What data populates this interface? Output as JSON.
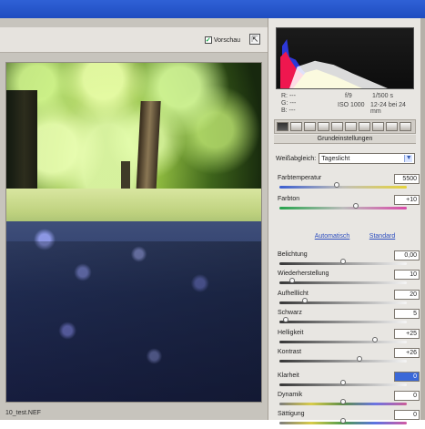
{
  "header": {
    "preview_label": "Vorschau",
    "preview_checked": true
  },
  "image": {
    "filename": "10_test.NEF"
  },
  "exif": {
    "rgb": [
      "R: ---",
      "G: ---",
      "B: ---"
    ],
    "aperture": "f/9",
    "shutter": "1/500 s",
    "iso": "ISO 1000",
    "lens": "12-24 bei 24 mm"
  },
  "panel": {
    "section_title": "Grundeinstellungen",
    "white_balance_label": "Weißabgleich:",
    "white_balance_value": "Tageslicht",
    "automatic_label": "Automatisch",
    "standard_label": "Standard"
  },
  "controls": [
    {
      "label": "Farbtemperatur",
      "value": "5500",
      "level": 0.45,
      "track": "temp"
    },
    {
      "label": "Farbton",
      "value": "+10",
      "level": 0.6,
      "track": "tint"
    },
    {
      "label": "Belichtung",
      "value": "0,00",
      "level": 0.5,
      "track": "normal"
    },
    {
      "label": "Wiederherstellung",
      "value": "10",
      "level": 0.1,
      "track": "normal"
    },
    {
      "label": "Aufhelllicht",
      "value": "20",
      "level": 0.2,
      "track": "normal"
    },
    {
      "label": "Schwarz",
      "value": "5",
      "level": 0.05,
      "track": "normal"
    },
    {
      "label": "Helligkeit",
      "value": "+25",
      "level": 0.75,
      "track": "normal"
    },
    {
      "label": "Kontrast",
      "value": "+26",
      "level": 0.63,
      "track": "normal"
    },
    {
      "label": "Klarheit",
      "value": "0",
      "level": 0.5,
      "track": "normal",
      "selected": true
    },
    {
      "label": "Dynamik",
      "value": "0",
      "level": 0.5,
      "track": "vib"
    },
    {
      "label": "Sättigung",
      "value": "0",
      "level": 0.5,
      "track": "sat"
    }
  ]
}
